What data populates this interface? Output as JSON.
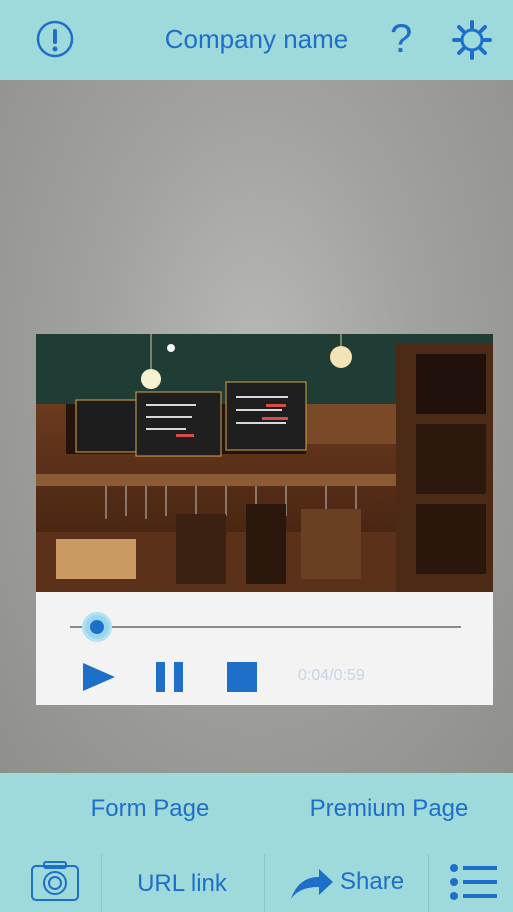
{
  "header": {
    "title": "Company name",
    "alert_icon": "exclamation-circle-icon",
    "help_icon": "question-icon",
    "settings_icon": "gear-icon",
    "help_label": "?"
  },
  "player": {
    "time": "0:04/0:59",
    "progress_fraction": 0.07
  },
  "footer": {
    "form_page": "Form Page",
    "premium_page": "Premium Page",
    "url_link": "URL link",
    "share": "Share",
    "camera_icon": "camera-icon",
    "share_icon": "share-arrow-icon",
    "menu_icon": "menu-list-icon"
  },
  "colors": {
    "accent": "#1e6fc7",
    "bar_bg": "#9ed9dc"
  }
}
